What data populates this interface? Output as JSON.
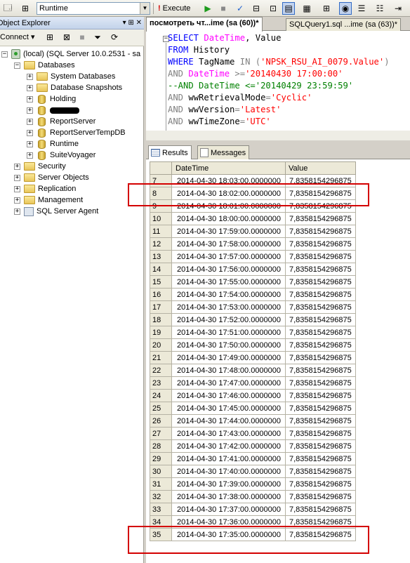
{
  "toolbar": {
    "database": "Runtime",
    "execute_label": "Execute"
  },
  "object_explorer": {
    "title": "Object Explorer",
    "title_controls": "▾ ⊞ ✕",
    "connect_label": "Connect ▾",
    "server": "(local) (SQL Server 10.0.2531 - sa",
    "databases_label": "Databases",
    "databases": [
      {
        "label": "System Databases",
        "type": "folder"
      },
      {
        "label": "Database Snapshots",
        "type": "folder"
      },
      {
        "label": "Holding",
        "type": "db"
      },
      {
        "label": "",
        "type": "db",
        "redacted": true
      },
      {
        "label": "ReportServer",
        "type": "db"
      },
      {
        "label": "ReportServerTempDB",
        "type": "db"
      },
      {
        "label": "Runtime",
        "type": "db"
      },
      {
        "label": "SuiteVoyager",
        "type": "db"
      }
    ],
    "top_items": [
      "Security",
      "Server Objects",
      "Replication",
      "Management",
      "SQL Server Agent"
    ]
  },
  "tabs": [
    {
      "label": "посмотреть чт...ime (sa (60))*",
      "active": true
    },
    {
      "label": "SQLQuery1.sql ...ime (sa (63))*",
      "active": false
    }
  ],
  "query": {
    "line1": {
      "kw": "SELECT",
      "a": " DateTime",
      "b": ", Value"
    },
    "line2": {
      "kw": "FROM",
      "a": " History"
    },
    "line3": {
      "kw": "WHERE",
      "a": " TagName ",
      "op": "IN",
      "b": " (",
      "s": "'NPSK_RSU_AI_0079.Value'",
      "c": ")"
    },
    "line4": {
      "op": "AND",
      "fn": " DateTime",
      "b": " >=",
      "s": "'20140430 17:00:00'"
    },
    "line5": {
      "text": "--AND DateTime <='20140429 23:59:59'"
    },
    "line6": {
      "op": "AND",
      "a": " wwRetrievalMode",
      "b": "=",
      "s": "'Cyclic'"
    },
    "line7": {
      "op": "AND",
      "a": " wwVersion",
      "b": "=",
      "s": "'Latest'"
    },
    "line8": {
      "op": "AND",
      "a": " wwTimeZone",
      "b": "=",
      "s": "'UTC'"
    }
  },
  "result_tabs": {
    "results": "Results",
    "messages": "Messages"
  },
  "grid": {
    "columns": [
      "DateTime",
      "Value"
    ],
    "rows": [
      {
        "n": "7",
        "dt": "2014-04-30 18:03:00.0000000",
        "v": "7,8358154296875"
      },
      {
        "n": "8",
        "dt": "2014-04-30 18:02:00.0000000",
        "v": "7,8358154296875"
      },
      {
        "n": "9",
        "dt": "2014-04-30 18:01:00.0000000",
        "v": "7,8358154296875"
      },
      {
        "n": "10",
        "dt": "2014-04-30 18:00:00.0000000",
        "v": "7,8358154296875"
      },
      {
        "n": "11",
        "dt": "2014-04-30 17:59:00.0000000",
        "v": "7,8358154296875"
      },
      {
        "n": "12",
        "dt": "2014-04-30 17:58:00.0000000",
        "v": "7,8358154296875"
      },
      {
        "n": "13",
        "dt": "2014-04-30 17:57:00.0000000",
        "v": "7,8358154296875"
      },
      {
        "n": "14",
        "dt": "2014-04-30 17:56:00.0000000",
        "v": "7,8358154296875"
      },
      {
        "n": "15",
        "dt": "2014-04-30 17:55:00.0000000",
        "v": "7,8358154296875"
      },
      {
        "n": "16",
        "dt": "2014-04-30 17:54:00.0000000",
        "v": "7,8358154296875"
      },
      {
        "n": "17",
        "dt": "2014-04-30 17:53:00.0000000",
        "v": "7,8358154296875"
      },
      {
        "n": "18",
        "dt": "2014-04-30 17:52:00.0000000",
        "v": "7,8358154296875"
      },
      {
        "n": "19",
        "dt": "2014-04-30 17:51:00.0000000",
        "v": "7,8358154296875"
      },
      {
        "n": "20",
        "dt": "2014-04-30 17:50:00.0000000",
        "v": "7,8358154296875"
      },
      {
        "n": "21",
        "dt": "2014-04-30 17:49:00.0000000",
        "v": "7,8358154296875"
      },
      {
        "n": "22",
        "dt": "2014-04-30 17:48:00.0000000",
        "v": "7,8358154296875"
      },
      {
        "n": "23",
        "dt": "2014-04-30 17:47:00.0000000",
        "v": "7,8358154296875"
      },
      {
        "n": "24",
        "dt": "2014-04-30 17:46:00.0000000",
        "v": "7,8358154296875"
      },
      {
        "n": "25",
        "dt": "2014-04-30 17:45:00.0000000",
        "v": "7,8358154296875"
      },
      {
        "n": "26",
        "dt": "2014-04-30 17:44:00.0000000",
        "v": "7,8358154296875"
      },
      {
        "n": "27",
        "dt": "2014-04-30 17:43:00.0000000",
        "v": "7,8358154296875"
      },
      {
        "n": "28",
        "dt": "2014-04-30 17:42:00.0000000",
        "v": "7,8358154296875"
      },
      {
        "n": "29",
        "dt": "2014-04-30 17:41:00.0000000",
        "v": "7,8358154296875"
      },
      {
        "n": "30",
        "dt": "2014-04-30 17:40:00.0000000",
        "v": "7,8358154296875"
      },
      {
        "n": "31",
        "dt": "2014-04-30 17:39:00.0000000",
        "v": "7,8358154296875"
      },
      {
        "n": "32",
        "dt": "2014-04-30 17:38:00.0000000",
        "v": "7,8358154296875"
      },
      {
        "n": "33",
        "dt": "2014-04-30 17:37:00.0000000",
        "v": "7,8358154296875"
      },
      {
        "n": "34",
        "dt": "2014-04-30 17:36:00.0000000",
        "v": "7,8358154296875"
      },
      {
        "n": "35",
        "dt": "2014-04-30 17:35:00.0000000",
        "v": "7,8358154296875"
      }
    ]
  },
  "colors": {
    "highlight": "#d40000",
    "keyword": "#0000ff",
    "function": "#ff00ff",
    "string": "#ff0000",
    "comment": "#008000"
  }
}
